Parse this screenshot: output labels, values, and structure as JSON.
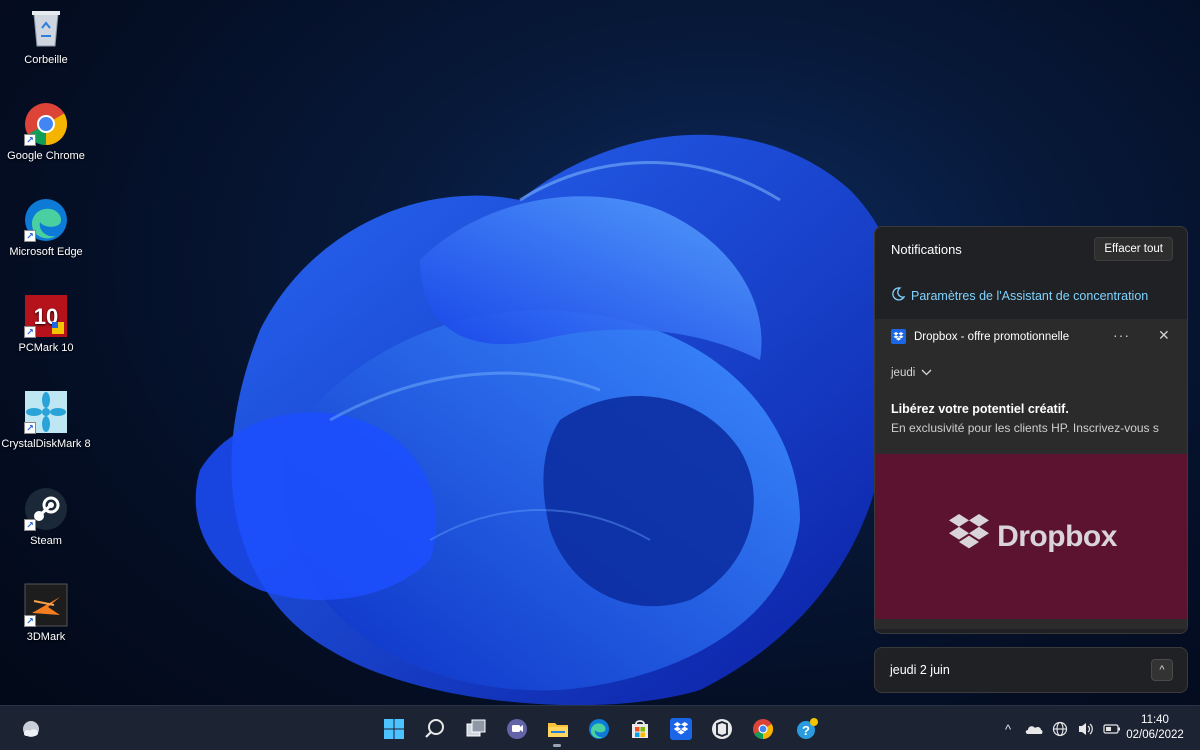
{
  "desktop": {
    "icons": [
      {
        "label": "Corbeille",
        "icon": "recycle-bin-icon"
      },
      {
        "label": "Google Chrome",
        "icon": "chrome-icon"
      },
      {
        "label": "Microsoft Edge",
        "icon": "edge-icon"
      },
      {
        "label": "PCMark 10",
        "icon": "pcmark-icon"
      },
      {
        "label": "CrystalDiskMark 8",
        "icon": "crystaldiskmark-icon"
      },
      {
        "label": "Steam",
        "icon": "steam-icon"
      },
      {
        "label": "3DMark",
        "icon": "3dmark-icon"
      }
    ],
    "pcmark_badge": "10"
  },
  "notifications": {
    "title": "Notifications",
    "clear_all": "Effacer tout",
    "focus_assist": "Paramètres de l'Assistant de concentration",
    "toast": {
      "app_name": "Dropbox - offre promotionnelle",
      "more": "···",
      "close": "✕",
      "day": "jeudi",
      "title": "Libérez votre potentiel créatif.",
      "body": "En exclusivité pour les clients HP. Inscrivez-vous s",
      "promo_brand": "Dropbox",
      "promo_color": "#5c1330"
    }
  },
  "calendar": {
    "date_label": "jeudi 2 juin",
    "toggle": "^"
  },
  "taskbar": {
    "items": [
      "start-icon",
      "search-icon",
      "task-view-icon",
      "teams-chat-icon",
      "file-explorer-icon",
      "edge-icon",
      "store-icon",
      "dropbox-icon",
      "hp-icon",
      "chrome-icon",
      "tips-icon"
    ],
    "tray": {
      "chevron": "^"
    },
    "time": "11:40",
    "date": "02/06/2022"
  },
  "colors": {
    "accent_link": "#7fd3ff",
    "panel_bg": "#202124",
    "taskbar_bg": "#1c2333"
  }
}
